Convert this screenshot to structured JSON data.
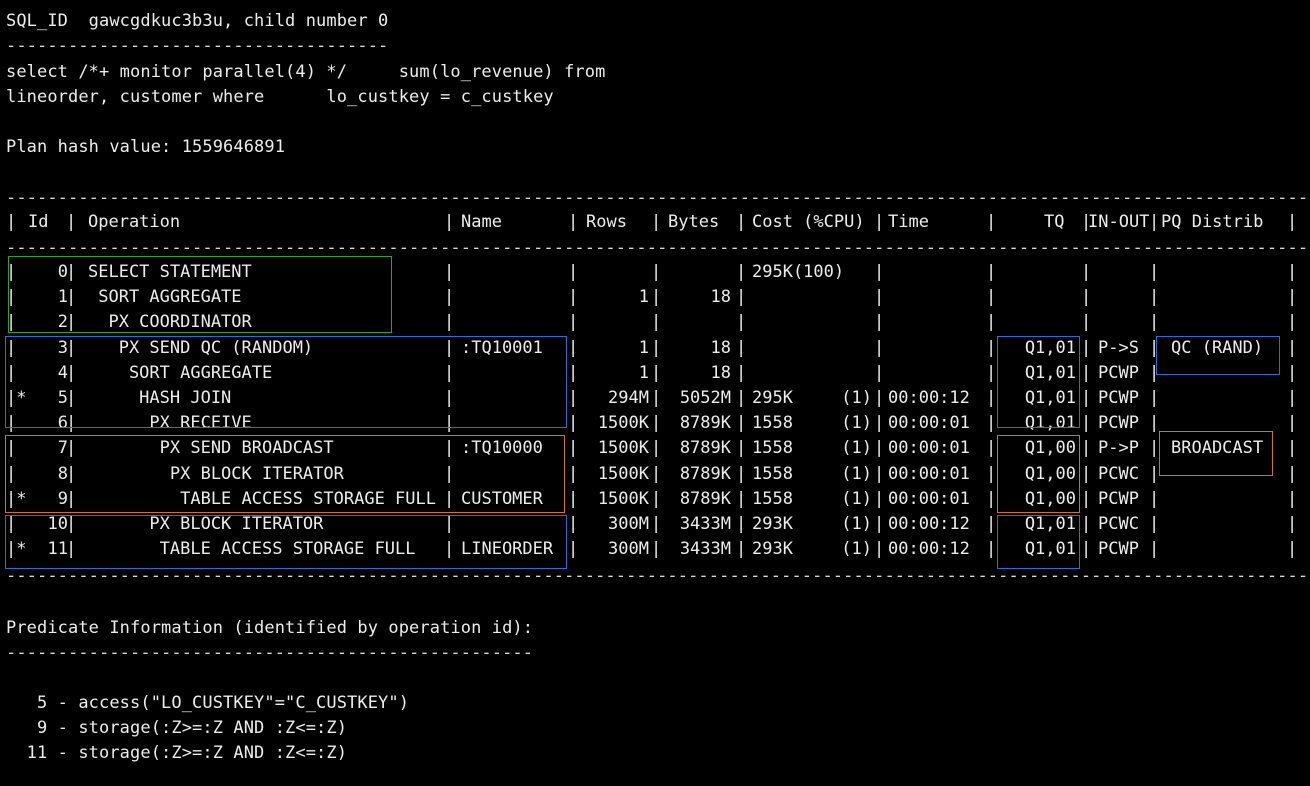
{
  "header": {
    "sql_id_line": "SQL_ID  gawcgdkuc3b3u, child number 0",
    "sep1": "-------------------------------------",
    "sql_line1": "select /*+ monitor parallel(4) */     sum(lo_revenue) from",
    "sql_line2": "lineorder, customer where      lo_custkey = c_custkey",
    "plan_hash": "Plan hash value: 1559646891"
  },
  "table": {
    "rule": "-----------------------------------------------------------------------------------------------------------------------------------",
    "columns": [
      "Id",
      "Operation",
      "Name",
      "Rows",
      "Bytes",
      "Cost (%CPU)",
      "Time",
      "TQ",
      "IN-OUT",
      "PQ Distrib"
    ],
    "rows": [
      {
        "star": "",
        "id": "0",
        "op": "SELECT STATEMENT",
        "name": "",
        "rows": "",
        "bytes": "",
        "cost": "295K(100)",
        "cpu": "",
        "time": "",
        "tq": "",
        "inout": "",
        "pq": ""
      },
      {
        "star": "",
        "id": "1",
        "op": " SORT AGGREGATE",
        "name": "",
        "rows": "1",
        "bytes": "18",
        "cost": "",
        "cpu": "",
        "time": "",
        "tq": "",
        "inout": "",
        "pq": ""
      },
      {
        "star": "",
        "id": "2",
        "op": "  PX COORDINATOR",
        "name": "",
        "rows": "",
        "bytes": "",
        "cost": "",
        "cpu": "",
        "time": "",
        "tq": "",
        "inout": "",
        "pq": ""
      },
      {
        "star": "",
        "id": "3",
        "op": "   PX SEND QC (RANDOM)",
        "name": ":TQ10001",
        "rows": "1",
        "bytes": "18",
        "cost": "",
        "cpu": "",
        "time": "",
        "tq": "Q1,01",
        "inout": "P->S",
        "pq": "QC (RAND)"
      },
      {
        "star": "",
        "id": "4",
        "op": "    SORT AGGREGATE",
        "name": "",
        "rows": "1",
        "bytes": "18",
        "cost": "",
        "cpu": "",
        "time": "",
        "tq": "Q1,01",
        "inout": "PCWP",
        "pq": ""
      },
      {
        "star": "*",
        "id": "5",
        "op": "     HASH JOIN",
        "name": "",
        "rows": "294M",
        "bytes": "5052M",
        "cost": "295K",
        "cpu": "(1)",
        "time": "00:00:12",
        "tq": "Q1,01",
        "inout": "PCWP",
        "pq": ""
      },
      {
        "star": "",
        "id": "6",
        "op": "      PX RECEIVE",
        "name": "",
        "rows": "1500K",
        "bytes": "8789K",
        "cost": "1558",
        "cpu": "(1)",
        "time": "00:00:01",
        "tq": "Q1,01",
        "inout": "PCWP",
        "pq": ""
      },
      {
        "star": "",
        "id": "7",
        "op": "       PX SEND BROADCAST",
        "name": ":TQ10000",
        "rows": "1500K",
        "bytes": "8789K",
        "cost": "1558",
        "cpu": "(1)",
        "time": "00:00:01",
        "tq": "Q1,00",
        "inout": "P->P",
        "pq": "BROADCAST"
      },
      {
        "star": "",
        "id": "8",
        "op": "        PX BLOCK ITERATOR",
        "name": "",
        "rows": "1500K",
        "bytes": "8789K",
        "cost": "1558",
        "cpu": "(1)",
        "time": "00:00:01",
        "tq": "Q1,00",
        "inout": "PCWC",
        "pq": ""
      },
      {
        "star": "*",
        "id": "9",
        "op": "         TABLE ACCESS STORAGE FULL",
        "name": "CUSTOMER",
        "rows": "1500K",
        "bytes": "8789K",
        "cost": "1558",
        "cpu": "(1)",
        "time": "00:00:01",
        "tq": "Q1,00",
        "inout": "PCWP",
        "pq": ""
      },
      {
        "star": "",
        "id": "10",
        "op": "      PX BLOCK ITERATOR",
        "name": "",
        "rows": "300M",
        "bytes": "3433M",
        "cost": "293K",
        "cpu": "(1)",
        "time": "00:00:12",
        "tq": "Q1,01",
        "inout": "PCWC",
        "pq": ""
      },
      {
        "star": "*",
        "id": "11",
        "op": "       TABLE ACCESS STORAGE FULL",
        "name": "LINEORDER",
        "rows": "300M",
        "bytes": "3433M",
        "cost": "293K",
        "cpu": "(1)",
        "time": "00:00:12",
        "tq": "Q1,01",
        "inout": "PCWP",
        "pq": ""
      }
    ]
  },
  "predicate": {
    "title": "Predicate Information (identified by operation id):",
    "sep": "---------------------------------------------------",
    "lines": [
      "   5 - access(\"LO_CUSTKEY\"=\"C_CUSTKEY\")",
      "   9 - storage(:Z>=:Z AND :Z<=:Z)",
      "  11 - storage(:Z>=:Z AND :Z<=:Z)"
    ]
  },
  "highlight_colors": {
    "coordinator": "#2fa32f",
    "consumer_set": "#2b6fd1",
    "producer_set": "#d2741f"
  }
}
